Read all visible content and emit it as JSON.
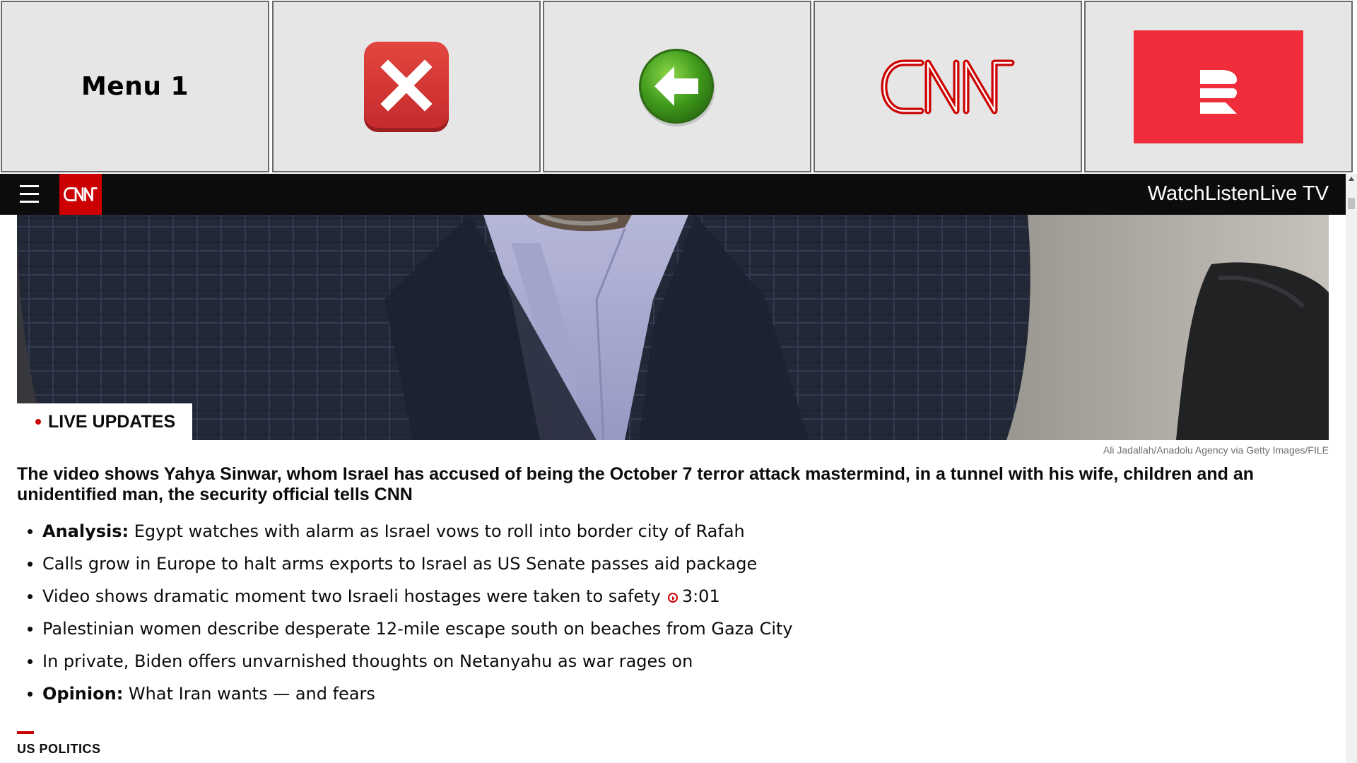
{
  "control_panel": {
    "menu_label": "Menu 1",
    "close_icon": "close-icon",
    "back_icon": "back-arrow-icon",
    "cnn_logo_text": "CNN",
    "radio_logo": "radio-logo-icon",
    "colors": {
      "tile_bg": "#e6e6e6",
      "close_red": "#d6393a",
      "back_green": "#3f9a1c",
      "cnn_red": "#cc0000",
      "radio_red": "#ef2d3b"
    }
  },
  "nav": {
    "menu_icon": "hamburger-icon",
    "logo_text": "CNN",
    "links": [
      "Watch",
      "Listen",
      "Live TV"
    ]
  },
  "hero": {
    "badge": "LIVE UPDATES",
    "credit": "Ali Jadallah/Anadolu Agency via Getty Images/FILE"
  },
  "headline": "The video shows Yahya Sinwar, whom Israel has accused of being the October 7 terror attack mastermind, in a tunnel with his wife, children and an unidentified man, the security official tells CNN",
  "bullets": [
    {
      "prefix": "Analysis:",
      "text": " Egypt watches with alarm as Israel vows to roll into border city of Rafah"
    },
    {
      "prefix": "",
      "text": "Calls grow in Europe to halt arms exports to Israel as US Senate passes aid package"
    },
    {
      "prefix": "",
      "text": "Video shows dramatic moment two Israeli hostages were taken to safety",
      "duration": "3:01"
    },
    {
      "prefix": "",
      "text": "Palestinian women describe desperate 12-mile escape south on beaches from Gaza City"
    },
    {
      "prefix": "",
      "text": "In private, Biden offers unvarnished thoughts on Netanyahu as war rages on"
    },
    {
      "prefix": "Opinion:",
      "text": " What Iran wants — and fears"
    }
  ],
  "next_section": "US POLITICS"
}
